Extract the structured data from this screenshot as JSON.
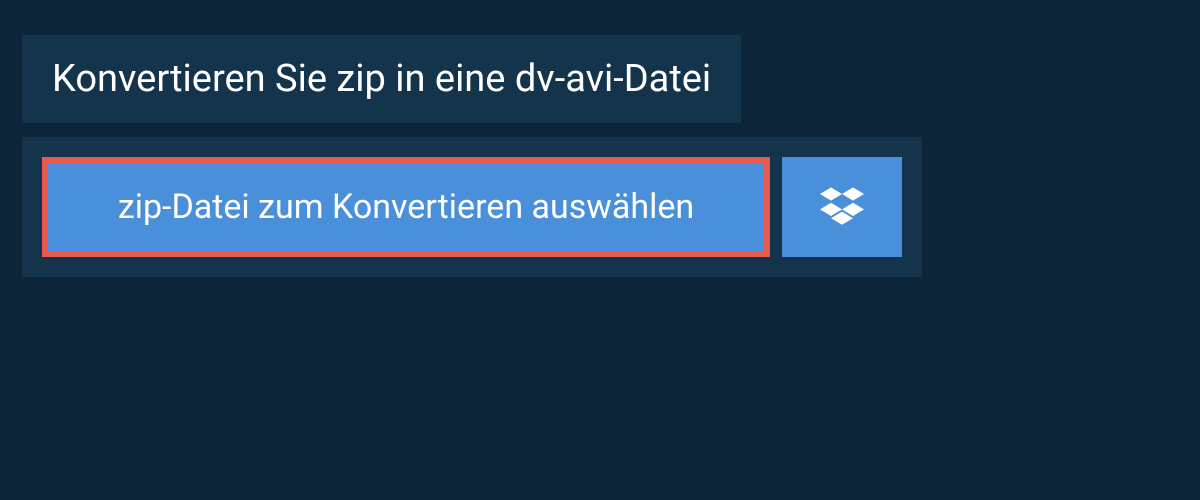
{
  "header": {
    "title": "Konvertieren Sie zip in eine dv-avi-Datei"
  },
  "upload": {
    "select_file_label": "zip-Datei zum Konvertieren auswählen",
    "dropbox_icon_name": "dropbox-icon"
  },
  "colors": {
    "background": "#0d2538",
    "panel": "#14344c",
    "button": "#4a8fd9",
    "highlight_border": "#e85a4f"
  }
}
